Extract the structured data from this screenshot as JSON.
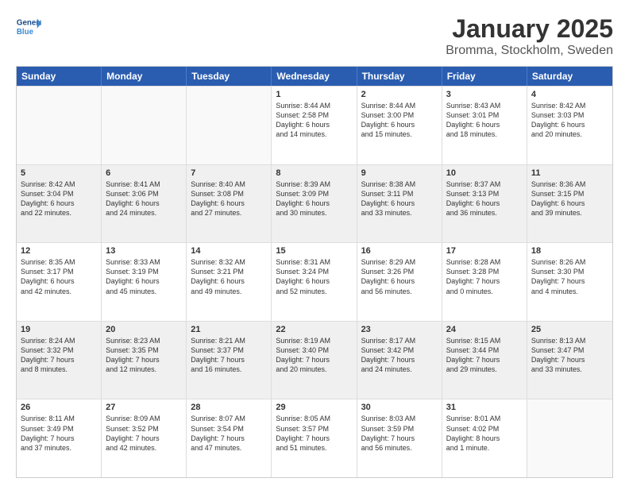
{
  "logo": {
    "line1": "General",
    "line2": "Blue"
  },
  "title": "January 2025",
  "subtitle": "Bromma, Stockholm, Sweden",
  "header_days": [
    "Sunday",
    "Monday",
    "Tuesday",
    "Wednesday",
    "Thursday",
    "Friday",
    "Saturday"
  ],
  "weeks": [
    [
      {
        "day": "",
        "text": ""
      },
      {
        "day": "",
        "text": ""
      },
      {
        "day": "",
        "text": ""
      },
      {
        "day": "1",
        "text": "Sunrise: 8:44 AM\nSunset: 2:58 PM\nDaylight: 6 hours\nand 14 minutes."
      },
      {
        "day": "2",
        "text": "Sunrise: 8:44 AM\nSunset: 3:00 PM\nDaylight: 6 hours\nand 15 minutes."
      },
      {
        "day": "3",
        "text": "Sunrise: 8:43 AM\nSunset: 3:01 PM\nDaylight: 6 hours\nand 18 minutes."
      },
      {
        "day": "4",
        "text": "Sunrise: 8:42 AM\nSunset: 3:03 PM\nDaylight: 6 hours\nand 20 minutes."
      }
    ],
    [
      {
        "day": "5",
        "text": "Sunrise: 8:42 AM\nSunset: 3:04 PM\nDaylight: 6 hours\nand 22 minutes."
      },
      {
        "day": "6",
        "text": "Sunrise: 8:41 AM\nSunset: 3:06 PM\nDaylight: 6 hours\nand 24 minutes."
      },
      {
        "day": "7",
        "text": "Sunrise: 8:40 AM\nSunset: 3:08 PM\nDaylight: 6 hours\nand 27 minutes."
      },
      {
        "day": "8",
        "text": "Sunrise: 8:39 AM\nSunset: 3:09 PM\nDaylight: 6 hours\nand 30 minutes."
      },
      {
        "day": "9",
        "text": "Sunrise: 8:38 AM\nSunset: 3:11 PM\nDaylight: 6 hours\nand 33 minutes."
      },
      {
        "day": "10",
        "text": "Sunrise: 8:37 AM\nSunset: 3:13 PM\nDaylight: 6 hours\nand 36 minutes."
      },
      {
        "day": "11",
        "text": "Sunrise: 8:36 AM\nSunset: 3:15 PM\nDaylight: 6 hours\nand 39 minutes."
      }
    ],
    [
      {
        "day": "12",
        "text": "Sunrise: 8:35 AM\nSunset: 3:17 PM\nDaylight: 6 hours\nand 42 minutes."
      },
      {
        "day": "13",
        "text": "Sunrise: 8:33 AM\nSunset: 3:19 PM\nDaylight: 6 hours\nand 45 minutes."
      },
      {
        "day": "14",
        "text": "Sunrise: 8:32 AM\nSunset: 3:21 PM\nDaylight: 6 hours\nand 49 minutes."
      },
      {
        "day": "15",
        "text": "Sunrise: 8:31 AM\nSunset: 3:24 PM\nDaylight: 6 hours\nand 52 minutes."
      },
      {
        "day": "16",
        "text": "Sunrise: 8:29 AM\nSunset: 3:26 PM\nDaylight: 6 hours\nand 56 minutes."
      },
      {
        "day": "17",
        "text": "Sunrise: 8:28 AM\nSunset: 3:28 PM\nDaylight: 7 hours\nand 0 minutes."
      },
      {
        "day": "18",
        "text": "Sunrise: 8:26 AM\nSunset: 3:30 PM\nDaylight: 7 hours\nand 4 minutes."
      }
    ],
    [
      {
        "day": "19",
        "text": "Sunrise: 8:24 AM\nSunset: 3:32 PM\nDaylight: 7 hours\nand 8 minutes."
      },
      {
        "day": "20",
        "text": "Sunrise: 8:23 AM\nSunset: 3:35 PM\nDaylight: 7 hours\nand 12 minutes."
      },
      {
        "day": "21",
        "text": "Sunrise: 8:21 AM\nSunset: 3:37 PM\nDaylight: 7 hours\nand 16 minutes."
      },
      {
        "day": "22",
        "text": "Sunrise: 8:19 AM\nSunset: 3:40 PM\nDaylight: 7 hours\nand 20 minutes."
      },
      {
        "day": "23",
        "text": "Sunrise: 8:17 AM\nSunset: 3:42 PM\nDaylight: 7 hours\nand 24 minutes."
      },
      {
        "day": "24",
        "text": "Sunrise: 8:15 AM\nSunset: 3:44 PM\nDaylight: 7 hours\nand 29 minutes."
      },
      {
        "day": "25",
        "text": "Sunrise: 8:13 AM\nSunset: 3:47 PM\nDaylight: 7 hours\nand 33 minutes."
      }
    ],
    [
      {
        "day": "26",
        "text": "Sunrise: 8:11 AM\nSunset: 3:49 PM\nDaylight: 7 hours\nand 37 minutes."
      },
      {
        "day": "27",
        "text": "Sunrise: 8:09 AM\nSunset: 3:52 PM\nDaylight: 7 hours\nand 42 minutes."
      },
      {
        "day": "28",
        "text": "Sunrise: 8:07 AM\nSunset: 3:54 PM\nDaylight: 7 hours\nand 47 minutes."
      },
      {
        "day": "29",
        "text": "Sunrise: 8:05 AM\nSunset: 3:57 PM\nDaylight: 7 hours\nand 51 minutes."
      },
      {
        "day": "30",
        "text": "Sunrise: 8:03 AM\nSunset: 3:59 PM\nDaylight: 7 hours\nand 56 minutes."
      },
      {
        "day": "31",
        "text": "Sunrise: 8:01 AM\nSunset: 4:02 PM\nDaylight: 8 hours\nand 1 minute."
      },
      {
        "day": "",
        "text": ""
      }
    ]
  ]
}
